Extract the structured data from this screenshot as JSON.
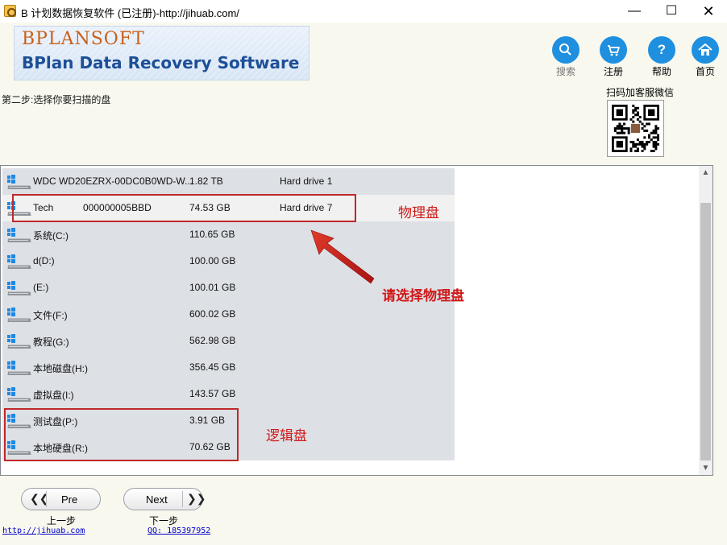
{
  "window": {
    "title": "B 计划数据恢复软件 (已注册)-http://jihuab.com/",
    "minimize_glyph": "—",
    "maximize_glyph": "☐",
    "close_glyph": "✕"
  },
  "banner": {
    "brand_logo": "BPLANSOFT",
    "product_name": "BPlan Data Recovery Software"
  },
  "toolbar": {
    "search": {
      "label": "搜索",
      "icon": "search-icon",
      "enabled": false
    },
    "register": {
      "label": "注册",
      "icon": "cart-icon",
      "enabled": true
    },
    "help": {
      "label": "帮助",
      "icon": "help-icon",
      "glyph": "?",
      "enabled": true
    },
    "home": {
      "label": "首页",
      "icon": "home-icon",
      "enabled": true
    }
  },
  "step_label": "第二步:选择你要扫描的盘",
  "qr": {
    "caption": "扫码加客服微信"
  },
  "drives": [
    {
      "name": "WDC WD20EZRX-00DC0B0WD-W...",
      "serial": "",
      "size": "1.82 TB",
      "type": "Hard drive 1"
    },
    {
      "name": "Tech",
      "serial": "000000005BBD",
      "size": "74.53 GB",
      "type": "Hard drive 7"
    },
    {
      "name": "系统(C:)",
      "serial": "",
      "size": "110.65 GB",
      "type": ""
    },
    {
      "name": "d(D:)",
      "serial": "",
      "size": "100.00 GB",
      "type": ""
    },
    {
      "name": "(E:)",
      "serial": "",
      "size": "100.01 GB",
      "type": ""
    },
    {
      "name": "文件(F:)",
      "serial": "",
      "size": "600.02 GB",
      "type": ""
    },
    {
      "name": "教程(G:)",
      "serial": "",
      "size": "562.98 GB",
      "type": ""
    },
    {
      "name": "本地磁盘(H:)",
      "serial": "",
      "size": "356.45 GB",
      "type": ""
    },
    {
      "name": "虚拟盘(I:)",
      "serial": "",
      "size": "143.57 GB",
      "type": ""
    },
    {
      "name": "测试盘(P:)",
      "serial": "",
      "size": "3.91 GB",
      "type": ""
    },
    {
      "name": "本地硬盘(R:)",
      "serial": "",
      "size": "70.62 GB",
      "type": ""
    }
  ],
  "annotations": {
    "physical_disk": "物理盘",
    "pick_physical": "请选择物理盘",
    "logical_disk": "逻辑盘"
  },
  "navigation": {
    "pre_label": "Pre",
    "pre_arrow": "❮❮",
    "pre_caption": "上一步",
    "next_label": "Next",
    "next_arrow": "❯❯",
    "next_caption": "下一步"
  },
  "footer": {
    "website": "http://jihuab.com",
    "qq": "QQ: 185397952"
  },
  "colors": {
    "accent_blue": "#1f8fe0",
    "annotation_red": "#c0282a",
    "brand_orange": "#c9601a",
    "brand_blue": "#1d4f97",
    "link_blue": "#0000cc"
  }
}
